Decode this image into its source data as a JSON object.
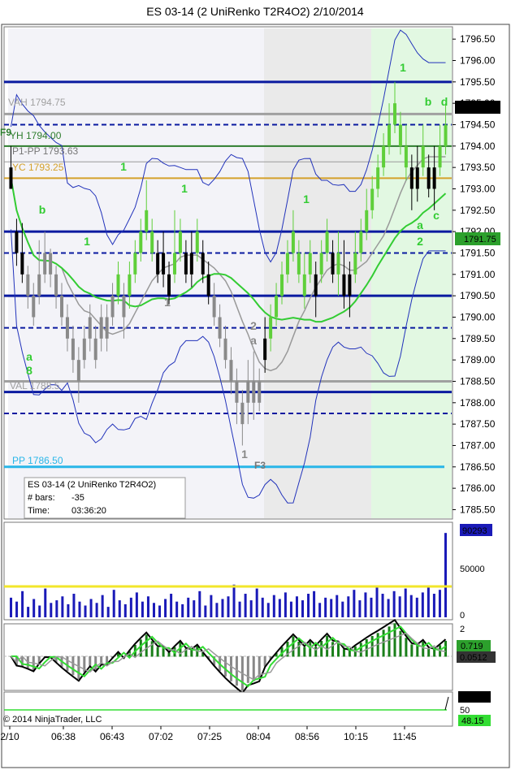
{
  "title": "ES 03-14 (2 UniRenko T2R4O2)  2/10/2014",
  "copyright": "© 2014 NinjaTrader, LLC",
  "info_box": {
    "line1": "ES 03-14 (2 UniRenko T2R4O2)",
    "line2_label": "# bars:",
    "line2_value": "-35",
    "line3_label": "Time:",
    "line3_value": "03:36:20"
  },
  "colors": {
    "up_bar": "#5fcf3a",
    "down_bar": "#000000",
    "gray_bar": "#8a8a8a",
    "navy_line": "#0a1aa0",
    "green_level": "#2e7d2e",
    "gold_level": "#d4a12a",
    "cyan_level": "#29b6e8",
    "gray_level": "#a0a0a0",
    "band_blue": "#2233bb",
    "volume_bar": "#1a1ab8",
    "volume_ref": "#f2e62a"
  },
  "level_labels": {
    "vah": "VAH 1794.75",
    "yh": "YH 1794.00",
    "p1pp": "P1-PP 1793.63",
    "yc": "YC 1793.25",
    "val": "VAL 1788.5",
    "pp": "PP 1786.50",
    "f9": "F9",
    "f3": "F3"
  },
  "wave_labels": {
    "one": "1",
    "two": "2",
    "a": "a",
    "b": "b",
    "c": "c",
    "d": "d",
    "eight": "8"
  },
  "price_panel": {
    "price_markers": {
      "current": "1794.75",
      "ma": "1791.75"
    }
  },
  "volume_panel": {
    "marker": "90293",
    "ticks": [
      "50000",
      "0"
    ]
  },
  "osc_panel": {
    "ticks": [
      "2"
    ],
    "markers": [
      "0.719",
      "0.0512"
    ]
  },
  "rsi_panel": {
    "ticks": [
      "50"
    ],
    "markers": [
      "51.85",
      "48.15"
    ]
  },
  "chart_data": {
    "type": "candlestick",
    "title": "ES 03-14 (2 UniRenko T2R4O2)  2/10/2014",
    "y_ticks": [
      1796.5,
      1796.0,
      1795.5,
      1795.0,
      1794.5,
      1794.0,
      1793.5,
      1793.0,
      1792.5,
      1792.0,
      1791.5,
      1791.0,
      1790.5,
      1790.0,
      1789.5,
      1789.0,
      1788.5,
      1788.0,
      1787.5,
      1787.0,
      1786.5,
      1786.0,
      1785.5
    ],
    "ylim": [
      1785.3,
      1796.75
    ],
    "x_tick_labels": [
      "2/10",
      "06:38",
      "06:43",
      "07:02",
      "07:25",
      "08:04",
      "08:56",
      "10:15",
      "11:45"
    ],
    "levels": [
      {
        "name": "VAH",
        "value": 1794.75
      },
      {
        "name": "YH",
        "value": 1794.0
      },
      {
        "name": "P1-PP",
        "value": 1793.63
      },
      {
        "name": "YC",
        "value": 1793.25
      },
      {
        "name": "VAL",
        "value": 1788.5
      },
      {
        "name": "PP",
        "value": 1786.5
      }
    ],
    "navy_solid_levels": [
      1795.5,
      1792.0,
      1790.5,
      1788.25
    ],
    "navy_dashed_levels": [
      1794.5,
      1791.5,
      1789.75,
      1787.75
    ],
    "bars": [
      {
        "o": 1793.0,
        "c": 1793.5,
        "h": 1794.0,
        "l": 1793.0,
        "color": "down"
      },
      {
        "o": 1791.5,
        "c": 1792.0,
        "h": 1792.3,
        "l": 1791.2,
        "color": "down"
      },
      {
        "o": 1791.0,
        "c": 1791.5,
        "h": 1792.2,
        "l": 1790.8,
        "color": "down"
      },
      {
        "o": 1790.5,
        "c": 1791.0,
        "h": 1791.2,
        "l": 1790.2,
        "color": "gray"
      },
      {
        "o": 1790.0,
        "c": 1790.5,
        "h": 1790.8,
        "l": 1789.8,
        "color": "gray"
      },
      {
        "o": 1790.5,
        "c": 1791.0,
        "h": 1791.8,
        "l": 1790.3,
        "color": "gray"
      },
      {
        "o": 1791.0,
        "c": 1791.5,
        "h": 1792.0,
        "l": 1790.8,
        "color": "gray"
      },
      {
        "o": 1791.0,
        "c": 1791.5,
        "h": 1791.6,
        "l": 1790.7,
        "color": "gray"
      },
      {
        "o": 1790.5,
        "c": 1791.0,
        "h": 1791.2,
        "l": 1790.2,
        "color": "gray"
      },
      {
        "o": 1790.0,
        "c": 1790.5,
        "h": 1790.8,
        "l": 1789.8,
        "color": "gray"
      },
      {
        "o": 1789.5,
        "c": 1790.0,
        "h": 1790.3,
        "l": 1789.2,
        "color": "gray"
      },
      {
        "o": 1789.0,
        "c": 1789.5,
        "h": 1789.8,
        "l": 1788.7,
        "color": "gray"
      },
      {
        "o": 1788.5,
        "c": 1789.0,
        "h": 1789.3,
        "l": 1788.0,
        "color": "gray"
      },
      {
        "o": 1789.0,
        "c": 1789.5,
        "h": 1789.8,
        "l": 1788.8,
        "color": "gray"
      },
      {
        "o": 1789.5,
        "c": 1790.0,
        "h": 1790.3,
        "l": 1789.2,
        "color": "gray"
      },
      {
        "o": 1789.0,
        "c": 1789.5,
        "h": 1789.8,
        "l": 1788.8,
        "color": "gray"
      },
      {
        "o": 1789.5,
        "c": 1790.0,
        "h": 1790.3,
        "l": 1789.2,
        "color": "gray"
      },
      {
        "o": 1789.5,
        "c": 1790.0,
        "h": 1790.3,
        "l": 1789.2,
        "color": "gray"
      },
      {
        "o": 1790.0,
        "c": 1790.5,
        "h": 1790.8,
        "l": 1789.8,
        "color": "gray"
      },
      {
        "o": 1790.5,
        "c": 1791.0,
        "h": 1791.3,
        "l": 1790.3,
        "color": "up"
      },
      {
        "o": 1790.0,
        "c": 1790.5,
        "h": 1790.8,
        "l": 1789.5,
        "color": "gray"
      },
      {
        "o": 1790.5,
        "c": 1791.0,
        "h": 1791.3,
        "l": 1790.2,
        "color": "up"
      },
      {
        "o": 1791.0,
        "c": 1791.5,
        "h": 1791.8,
        "l": 1790.8,
        "color": "up"
      },
      {
        "o": 1791.5,
        "c": 1792.0,
        "h": 1792.3,
        "l": 1791.3,
        "color": "up"
      },
      {
        "o": 1792.0,
        "c": 1792.5,
        "h": 1793.2,
        "l": 1791.8,
        "color": "up"
      },
      {
        "o": 1791.5,
        "c": 1792.0,
        "h": 1792.3,
        "l": 1791.3,
        "color": "up"
      },
      {
        "o": 1791.0,
        "c": 1791.5,
        "h": 1791.8,
        "l": 1790.8,
        "color": "down"
      },
      {
        "o": 1791.0,
        "c": 1791.5,
        "h": 1792.0,
        "l": 1790.7,
        "color": "down"
      },
      {
        "o": 1790.5,
        "c": 1791.0,
        "h": 1791.3,
        "l": 1790.3,
        "color": "down"
      },
      {
        "o": 1791.0,
        "c": 1791.5,
        "h": 1792.5,
        "l": 1790.8,
        "color": "up"
      },
      {
        "o": 1791.5,
        "c": 1792.0,
        "h": 1792.3,
        "l": 1791.3,
        "color": "up"
      },
      {
        "o": 1791.0,
        "c": 1791.5,
        "h": 1791.8,
        "l": 1790.8,
        "color": "down"
      },
      {
        "o": 1791.0,
        "c": 1791.5,
        "h": 1792.0,
        "l": 1790.7,
        "color": "down"
      },
      {
        "o": 1791.5,
        "c": 1792.0,
        "h": 1792.3,
        "l": 1791.3,
        "color": "up"
      },
      {
        "o": 1791.0,
        "c": 1791.5,
        "h": 1791.8,
        "l": 1790.8,
        "color": "down"
      },
      {
        "o": 1790.5,
        "c": 1791.0,
        "h": 1791.3,
        "l": 1790.3,
        "color": "down"
      },
      {
        "o": 1790.0,
        "c": 1790.5,
        "h": 1790.8,
        "l": 1789.8,
        "color": "gray"
      },
      {
        "o": 1789.5,
        "c": 1790.0,
        "h": 1790.3,
        "l": 1789.3,
        "color": "gray"
      },
      {
        "o": 1789.0,
        "c": 1789.5,
        "h": 1789.8,
        "l": 1788.8,
        "color": "gray"
      },
      {
        "o": 1788.5,
        "c": 1789.0,
        "h": 1789.3,
        "l": 1788.2,
        "color": "gray"
      },
      {
        "o": 1788.0,
        "c": 1788.5,
        "h": 1788.8,
        "l": 1787.5,
        "color": "gray"
      },
      {
        "o": 1787.5,
        "c": 1788.0,
        "h": 1788.3,
        "l": 1787.0,
        "color": "gray"
      },
      {
        "o": 1788.0,
        "c": 1788.5,
        "h": 1789.0,
        "l": 1787.5,
        "color": "gray"
      },
      {
        "o": 1788.0,
        "c": 1788.5,
        "h": 1789.2,
        "l": 1787.6,
        "color": "gray"
      },
      {
        "o": 1788.0,
        "c": 1788.5,
        "h": 1788.8,
        "l": 1787.8,
        "color": "gray"
      },
      {
        "o": 1789.0,
        "c": 1789.5,
        "h": 1790.0,
        "l": 1788.7,
        "color": "down"
      },
      {
        "o": 1789.5,
        "c": 1790.0,
        "h": 1790.3,
        "l": 1789.2,
        "color": "up"
      },
      {
        "o": 1790.0,
        "c": 1790.5,
        "h": 1790.8,
        "l": 1789.8,
        "color": "up"
      },
      {
        "o": 1790.5,
        "c": 1791.0,
        "h": 1791.3,
        "l": 1790.3,
        "color": "up"
      },
      {
        "o": 1791.0,
        "c": 1791.5,
        "h": 1791.8,
        "l": 1790.8,
        "color": "up"
      },
      {
        "o": 1791.5,
        "c": 1792.0,
        "h": 1792.5,
        "l": 1791.3,
        "color": "up"
      },
      {
        "o": 1791.0,
        "c": 1791.5,
        "h": 1791.8,
        "l": 1790.8,
        "color": "up"
      },
      {
        "o": 1790.5,
        "c": 1791.0,
        "h": 1791.5,
        "l": 1790.2,
        "color": "up"
      },
      {
        "o": 1791.0,
        "c": 1791.5,
        "h": 1791.8,
        "l": 1790.8,
        "color": "up"
      },
      {
        "o": 1790.5,
        "c": 1791.0,
        "h": 1791.3,
        "l": 1790.0,
        "color": "down"
      },
      {
        "o": 1791.0,
        "c": 1791.5,
        "h": 1791.8,
        "l": 1790.8,
        "color": "up"
      },
      {
        "o": 1791.5,
        "c": 1792.0,
        "h": 1792.3,
        "l": 1791.3,
        "color": "up"
      },
      {
        "o": 1791.0,
        "c": 1791.5,
        "h": 1791.8,
        "l": 1790.8,
        "color": "down"
      },
      {
        "o": 1791.0,
        "c": 1791.5,
        "h": 1792.0,
        "l": 1790.5,
        "color": "up"
      },
      {
        "o": 1790.5,
        "c": 1791.0,
        "h": 1791.8,
        "l": 1790.2,
        "color": "down"
      },
      {
        "o": 1790.5,
        "c": 1791.0,
        "h": 1791.3,
        "l": 1790.0,
        "color": "down"
      },
      {
        "o": 1791.0,
        "c": 1791.5,
        "h": 1792.0,
        "l": 1790.8,
        "color": "up"
      },
      {
        "o": 1791.5,
        "c": 1792.0,
        "h": 1792.3,
        "l": 1791.3,
        "color": "up"
      },
      {
        "o": 1792.0,
        "c": 1792.5,
        "h": 1793.0,
        "l": 1791.8,
        "color": "up"
      },
      {
        "o": 1792.5,
        "c": 1793.0,
        "h": 1793.3,
        "l": 1792.3,
        "color": "up"
      },
      {
        "o": 1793.0,
        "c": 1793.5,
        "h": 1793.8,
        "l": 1792.8,
        "color": "up"
      },
      {
        "o": 1793.5,
        "c": 1794.0,
        "h": 1794.3,
        "l": 1793.3,
        "color": "up"
      },
      {
        "o": 1794.0,
        "c": 1794.5,
        "h": 1795.0,
        "l": 1793.8,
        "color": "up"
      },
      {
        "o": 1794.5,
        "c": 1795.0,
        "h": 1795.5,
        "l": 1794.3,
        "color": "up"
      },
      {
        "o": 1794.0,
        "c": 1794.5,
        "h": 1794.8,
        "l": 1793.8,
        "color": "up"
      },
      {
        "o": 1793.5,
        "c": 1794.0,
        "h": 1794.5,
        "l": 1793.2,
        "color": "up"
      },
      {
        "o": 1793.0,
        "c": 1793.5,
        "h": 1793.8,
        "l": 1792.5,
        "color": "down"
      },
      {
        "o": 1793.0,
        "c": 1793.5,
        "h": 1794.0,
        "l": 1792.7,
        "color": "down"
      },
      {
        "o": 1793.5,
        "c": 1794.0,
        "h": 1794.5,
        "l": 1793.3,
        "color": "up"
      },
      {
        "o": 1793.0,
        "c": 1793.5,
        "h": 1793.8,
        "l": 1792.8,
        "color": "down"
      },
      {
        "o": 1793.0,
        "c": 1793.5,
        "h": 1794.0,
        "l": 1792.5,
        "color": "down"
      },
      {
        "o": 1793.5,
        "c": 1794.0,
        "h": 1794.5,
        "l": 1793.3,
        "color": "up"
      },
      {
        "o": 1794.0,
        "c": 1794.5,
        "h": 1795.0,
        "l": 1793.8,
        "color": "up"
      }
    ],
    "volume": [
      15,
      12,
      20,
      8,
      14,
      9,
      22,
      11,
      13,
      16,
      10,
      18,
      12,
      9,
      14,
      11,
      17,
      8,
      21,
      13,
      10,
      15,
      19,
      12,
      16,
      11,
      9,
      14,
      18,
      12,
      10,
      15,
      13,
      20,
      9,
      17,
      11,
      14,
      16,
      25,
      12,
      18,
      13,
      22,
      15,
      11,
      17,
      14,
      19,
      12,
      16,
      13,
      18,
      20,
      11,
      15,
      14,
      17,
      12,
      16,
      21,
      13,
      19,
      15,
      24,
      18,
      14,
      20,
      16,
      22,
      17,
      15,
      19,
      23,
      18,
      21,
      90293
    ],
    "volume_max": 100000,
    "volume_reference": 30000
  }
}
